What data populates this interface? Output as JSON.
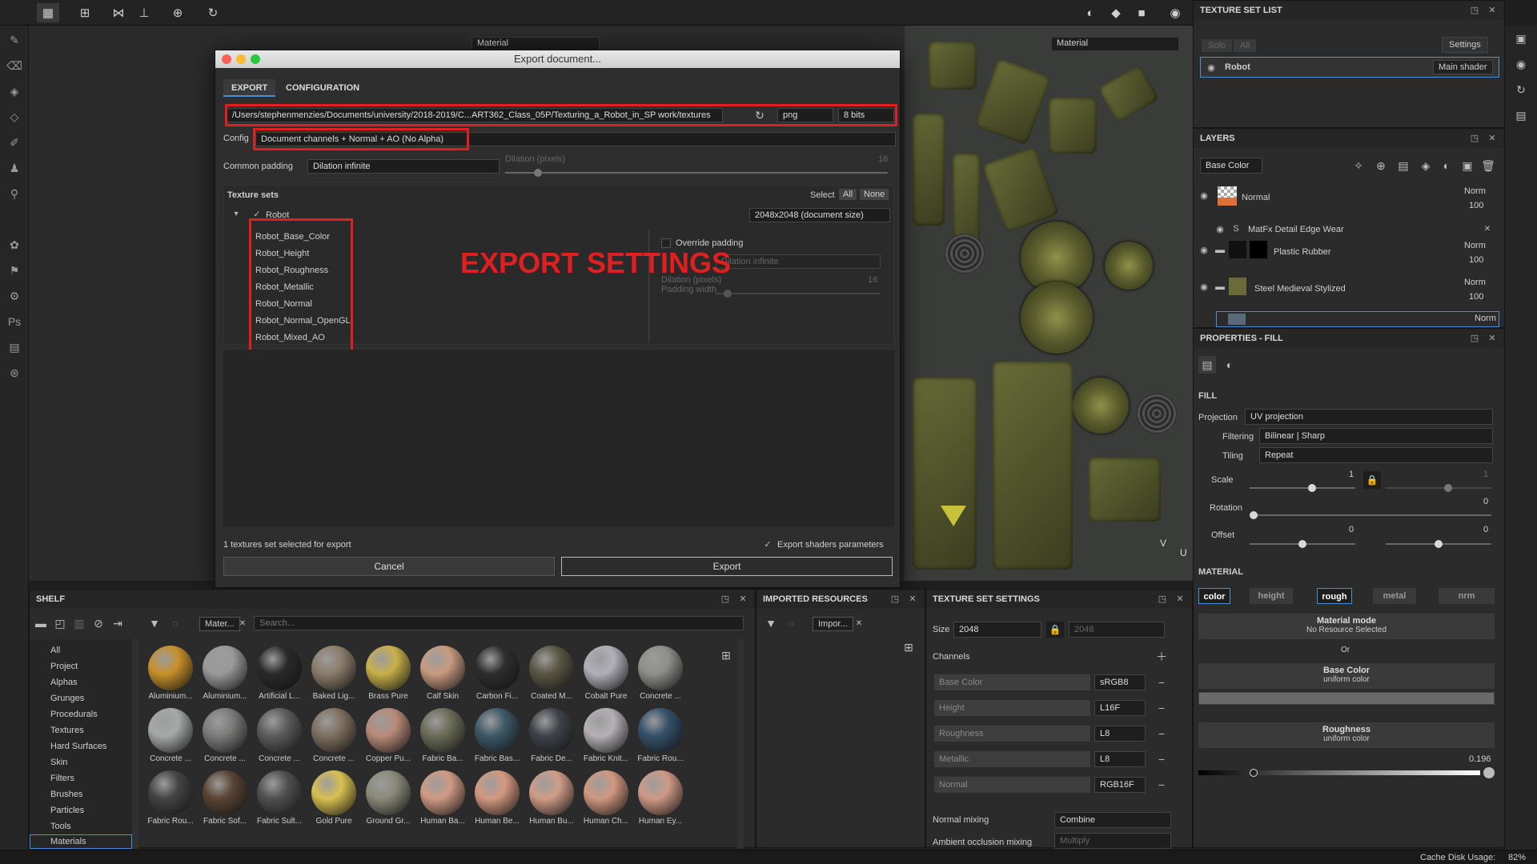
{
  "toolbar": {
    "icons": [
      "select-icon",
      "grid-icon",
      "mirror-icon",
      "align-icon",
      "add-icon",
      "history-icon"
    ],
    "right_icons": [
      "split-view-icon",
      "3d-view-icon",
      "camera-icon",
      "screenshot-icon"
    ]
  },
  "viewport": {
    "left_material": "Material",
    "right_material": "Material",
    "axis_v": "V",
    "axis_u": "U"
  },
  "dialog": {
    "title": "Export document...",
    "tabs": [
      "EXPORT",
      "CONFIGURATION"
    ],
    "path": "/Users/stephenmenzies/Documents/university/2018-2019/C...ART362_Class_05P/Texturing_a_Robot_in_SP work/textures",
    "format": "png",
    "bits": "8 bits",
    "config_label": "Config",
    "config_value": "Document channels + Normal + AO (No Alpha)",
    "padding_label": "Common padding",
    "padding_value": "Dilation infinite",
    "dilation_label": "Dilation (pixels)",
    "dilation_value": "16",
    "texture_sets_label": "Texture sets",
    "select_label": "Select",
    "select_all": "All",
    "select_none": "None",
    "set_name": "Robot",
    "set_size": "2048x2048 (document size)",
    "textures": [
      "Robot_Base_Color",
      "Robot_Height",
      "Robot_Roughness",
      "Robot_Metallic",
      "Robot_Normal",
      "Robot_Normal_OpenGL",
      "Robot_Mixed_AO"
    ],
    "override_label": "Override padding",
    "override_padding": "Dilation infinite",
    "padding_width_label": "Padding width",
    "override_dilation_label": "Dilation (pixels)",
    "override_dilation_value": "16",
    "annotation": "EXPORT SETTINGS",
    "status": "1 textures set selected for export",
    "export_shaders": "Export shaders parameters",
    "cancel": "Cancel",
    "export": "Export"
  },
  "texture_set_list": {
    "title": "TEXTURE SET LIST",
    "solo": "Solo",
    "all": "All",
    "settings": "Settings",
    "item": "Robot",
    "shader": "Main shader"
  },
  "layers": {
    "title": "LAYERS",
    "channel": "Base Color",
    "items": [
      {
        "name": "Normal",
        "blend": "Norm",
        "opacity": "100"
      },
      {
        "name": "MatFx Detail Edge Wear",
        "blend": "",
        "opacity": ""
      },
      {
        "name": "Plastic Rubber",
        "blend": "Norm",
        "opacity": "100"
      },
      {
        "name": "Steel Medieval Stylized",
        "blend": "Norm",
        "opacity": "100"
      },
      {
        "name": "",
        "blend": "Norm",
        "opacity": ""
      }
    ]
  },
  "properties": {
    "title": "PROPERTIES - FILL",
    "fill": "FILL",
    "projection_label": "Projection",
    "projection": "UV projection",
    "filtering_label": "Filtering",
    "filtering": "Bilinear | Sharp",
    "tiling_label": "Tiling",
    "tiling": "Repeat",
    "scale_label": "Scale",
    "scale_a": "1",
    "scale_b": "1",
    "scale_level": 0.5,
    "rotation_label": "Rotation",
    "rotation": "0",
    "offset_label": "Offset",
    "offset_a": "0",
    "offset_b": "0",
    "material": "MATERIAL",
    "chips": [
      "color",
      "height",
      "rough",
      "metal",
      "nrm"
    ],
    "material_mode": "Material mode",
    "no_resource": "No Resource Selected",
    "or": "Or",
    "base_color": "Base Color",
    "uniform1": "uniform color",
    "roughness": "Roughness",
    "uniform2": "uniform color",
    "rough_value": "0.196",
    "rough_level": 0.196
  },
  "shelf": {
    "title": "SHELF",
    "filter_tag": "Mater...",
    "search_placeholder": "Search...",
    "categories": [
      "All",
      "Project",
      "Alphas",
      "Grunges",
      "Procedurals",
      "Textures",
      "Hard Surfaces",
      "Skin",
      "Filters",
      "Brushes",
      "Particles",
      "Tools",
      "Materials"
    ],
    "materials": [
      {
        "name": "Aluminium...",
        "c": "#c8902a"
      },
      {
        "name": "Aluminium...",
        "c": "#9a9a9a"
      },
      {
        "name": "Artificial L...",
        "c": "#2a2a2a"
      },
      {
        "name": "Baked Lig...",
        "c": "#8c7d6c"
      },
      {
        "name": "Brass Pure",
        "c": "#c8b04a"
      },
      {
        "name": "Calf Skin",
        "c": "#c89a80"
      },
      {
        "name": "Carbon Fi...",
        "c": "#2e2e2e"
      },
      {
        "name": "Coated M...",
        "c": "#5a5644"
      },
      {
        "name": "Cobalt Pure",
        "c": "#b0b0b8"
      },
      {
        "name": "Concrete ...",
        "c": "#8e8e8a"
      },
      {
        "name": "Concrete ...",
        "c": "#a6a8a8"
      },
      {
        "name": "Concrete ...",
        "c": "#7a7c7a"
      },
      {
        "name": "Concrete ...",
        "c": "#5c5c5c"
      },
      {
        "name": "Concrete ...",
        "c": "#7e7060"
      },
      {
        "name": "Copper Pu...",
        "c": "#b88a78"
      },
      {
        "name": "Fabric Ba...",
        "c": "#6c6c58"
      },
      {
        "name": "Fabric Bas...",
        "c": "#3c5866"
      },
      {
        "name": "Fabric De...",
        "c": "#3e4248"
      },
      {
        "name": "Fabric Knit...",
        "c": "#b4b0b4"
      },
      {
        "name": "Fabric Rou...",
        "c": "#34506a"
      },
      {
        "name": "Fabric Rou...",
        "c": "#444"
      },
      {
        "name": "Fabric Sof...",
        "c": "#5a4434"
      },
      {
        "name": "Fabric Sult...",
        "c": "#505050"
      },
      {
        "name": "Gold Pure",
        "c": "#d8c050"
      },
      {
        "name": "Ground Gr...",
        "c": "#8a8a7a"
      },
      {
        "name": "Human Ba...",
        "c": "#d09a84"
      },
      {
        "name": "Human Be...",
        "c": "#d49880"
      },
      {
        "name": "Human Bu...",
        "c": "#d09c88"
      },
      {
        "name": "Human Ch...",
        "c": "#d09880"
      },
      {
        "name": "Human Ey...",
        "c": "#cf9a86"
      }
    ]
  },
  "imported": {
    "title": "IMPORTED RESOURCES",
    "filter_tag": "Impor..."
  },
  "tss": {
    "title": "TEXTURE SET SETTINGS",
    "size_label": "Size",
    "size": "2048",
    "size2": "2048",
    "channels_label": "Channels",
    "channels": [
      {
        "name": "Base Color",
        "fmt": "sRGB8"
      },
      {
        "name": "Height",
        "fmt": "L16F"
      },
      {
        "name": "Roughness",
        "fmt": "L8"
      },
      {
        "name": "Metallic",
        "fmt": "L8"
      },
      {
        "name": "Normal",
        "fmt": "RGB16F"
      }
    ],
    "normal_mixing_label": "Normal mixing",
    "normal_mixing": "Combine",
    "ao_mixing_label": "Ambient occlusion mixing",
    "ao_mixing": "Multiply"
  },
  "statusbar": {
    "cache": "Cache Disk Usage:",
    "cache_value": "82%"
  },
  "colors": {
    "accent": "#4a90d9",
    "annotation": "#e02020"
  }
}
